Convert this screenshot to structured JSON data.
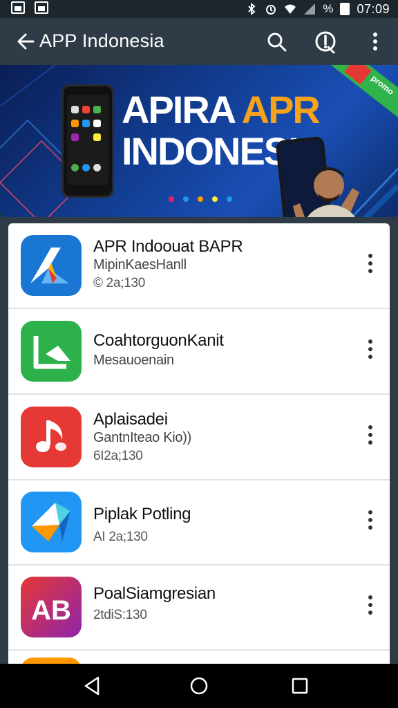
{
  "status_bar": {
    "time": "07:09",
    "icons": [
      "notification-icon",
      "image-icon",
      "bluetooth-icon",
      "alarm-icon",
      "wifi-icon",
      "signal-icon",
      "battery-icon"
    ],
    "battery_label": "%"
  },
  "app_bar": {
    "title": "APP Indonesia",
    "actions": [
      "search-icon",
      "info-icon",
      "more-vert-icon"
    ]
  },
  "banner": {
    "headline_part1": "APIRA",
    "headline_part2": "APR",
    "headline_line2": "INDONESIA",
    "corner_text": "promo",
    "accent_color": "#f7a21b",
    "page_dots": [
      "#e91e63",
      "#2196f3",
      "#ff9800",
      "#ffeb3b",
      "#2196f3"
    ]
  },
  "apps": [
    {
      "title": "APR Indoouat BAPR",
      "subtitle": "MipinKaesHanll",
      "meta": "© 2a;130",
      "icon": "arrow-logo-icon",
      "icon_color": "#1976d2"
    },
    {
      "title": "CoahtorguonKanit",
      "subtitle": "Mesauoenain",
      "meta": "",
      "icon": "share-logo-icon",
      "icon_color": "#2db14b"
    },
    {
      "title": "Aplaisadei",
      "subtitle": "GantnIteao Kio))",
      "meta": "6I2a;130",
      "icon": "music-note-icon",
      "icon_color": "#e53935"
    },
    {
      "title": "Piplak Potling",
      "subtitle": "",
      "meta": "AI 2a;130",
      "icon": "origami-logo-icon",
      "icon_color": "#2196f3"
    },
    {
      "title": "PoalSiamgresian",
      "subtitle": "",
      "meta": "2tdiS:130",
      "icon": "ab-logo-icon",
      "icon_color": "#d81b60"
    }
  ],
  "nav_bar": {
    "buttons": [
      "back-triangle-icon",
      "home-circle-icon",
      "recents-square-icon"
    ]
  }
}
